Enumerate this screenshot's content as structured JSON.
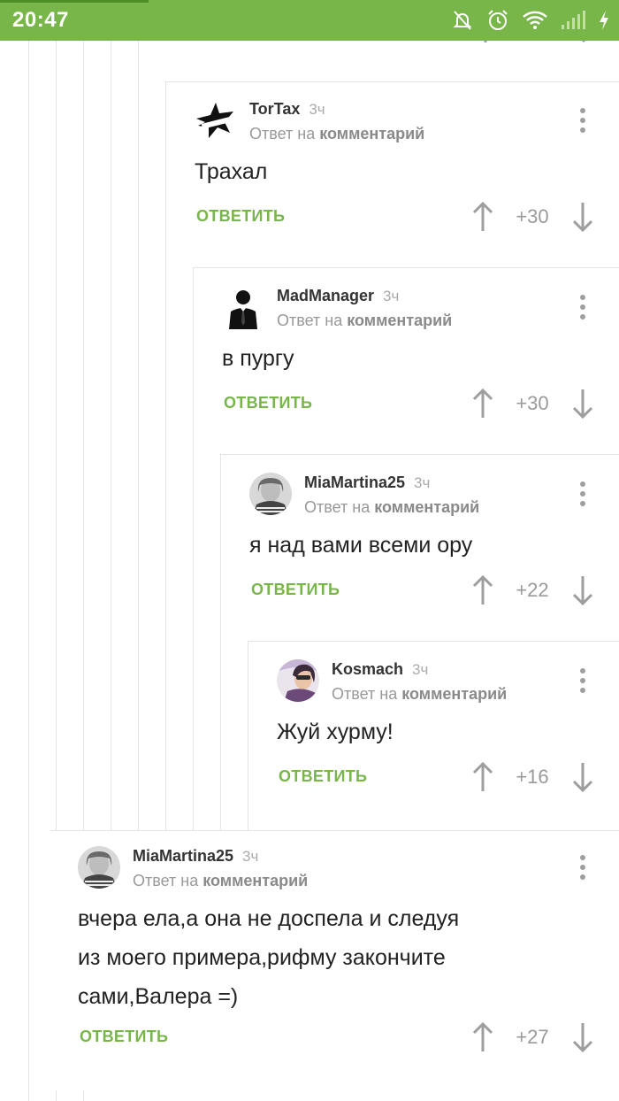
{
  "status_bar": {
    "time": "20:47",
    "icons": [
      "alarm-off-icon",
      "alarm-icon",
      "wifi-icon",
      "signal-icon",
      "charging-icon"
    ]
  },
  "labels": {
    "reply_prefix": "Ответ на",
    "reply_target": "комментарий",
    "reply_button": "ОТВЕТИТЬ"
  },
  "colors": {
    "accent": "#78b64a",
    "text": "#222222",
    "muted": "#999999"
  },
  "comments": [
    {
      "author": "TorTax",
      "time": "3ч",
      "avatar": "star-splat-avatar",
      "text": [
        "Трахал"
      ],
      "rating": "+30"
    },
    {
      "author": "MadManager",
      "time": "3ч",
      "avatar": "businessman-avatar",
      "text": [
        "в пургу"
      ],
      "rating": "+30"
    },
    {
      "author": "MiaMartina25",
      "time": "3ч",
      "avatar": "photo-avatar",
      "text": [
        "я над вами всеми ору"
      ],
      "rating": "+22"
    },
    {
      "author": "Kosmach",
      "time": "3ч",
      "avatar": "photo-avatar",
      "text": [
        "Жуй хурму!"
      ],
      "rating": "+16"
    },
    {
      "author": "MiaMartina25",
      "time": "3ч",
      "avatar": "photo-avatar",
      "text": [
        "вчера ела,а она не доспела и следуя",
        "из моего примера,рифму закончите",
        "сами,Валера =)"
      ],
      "rating": "+27"
    }
  ]
}
